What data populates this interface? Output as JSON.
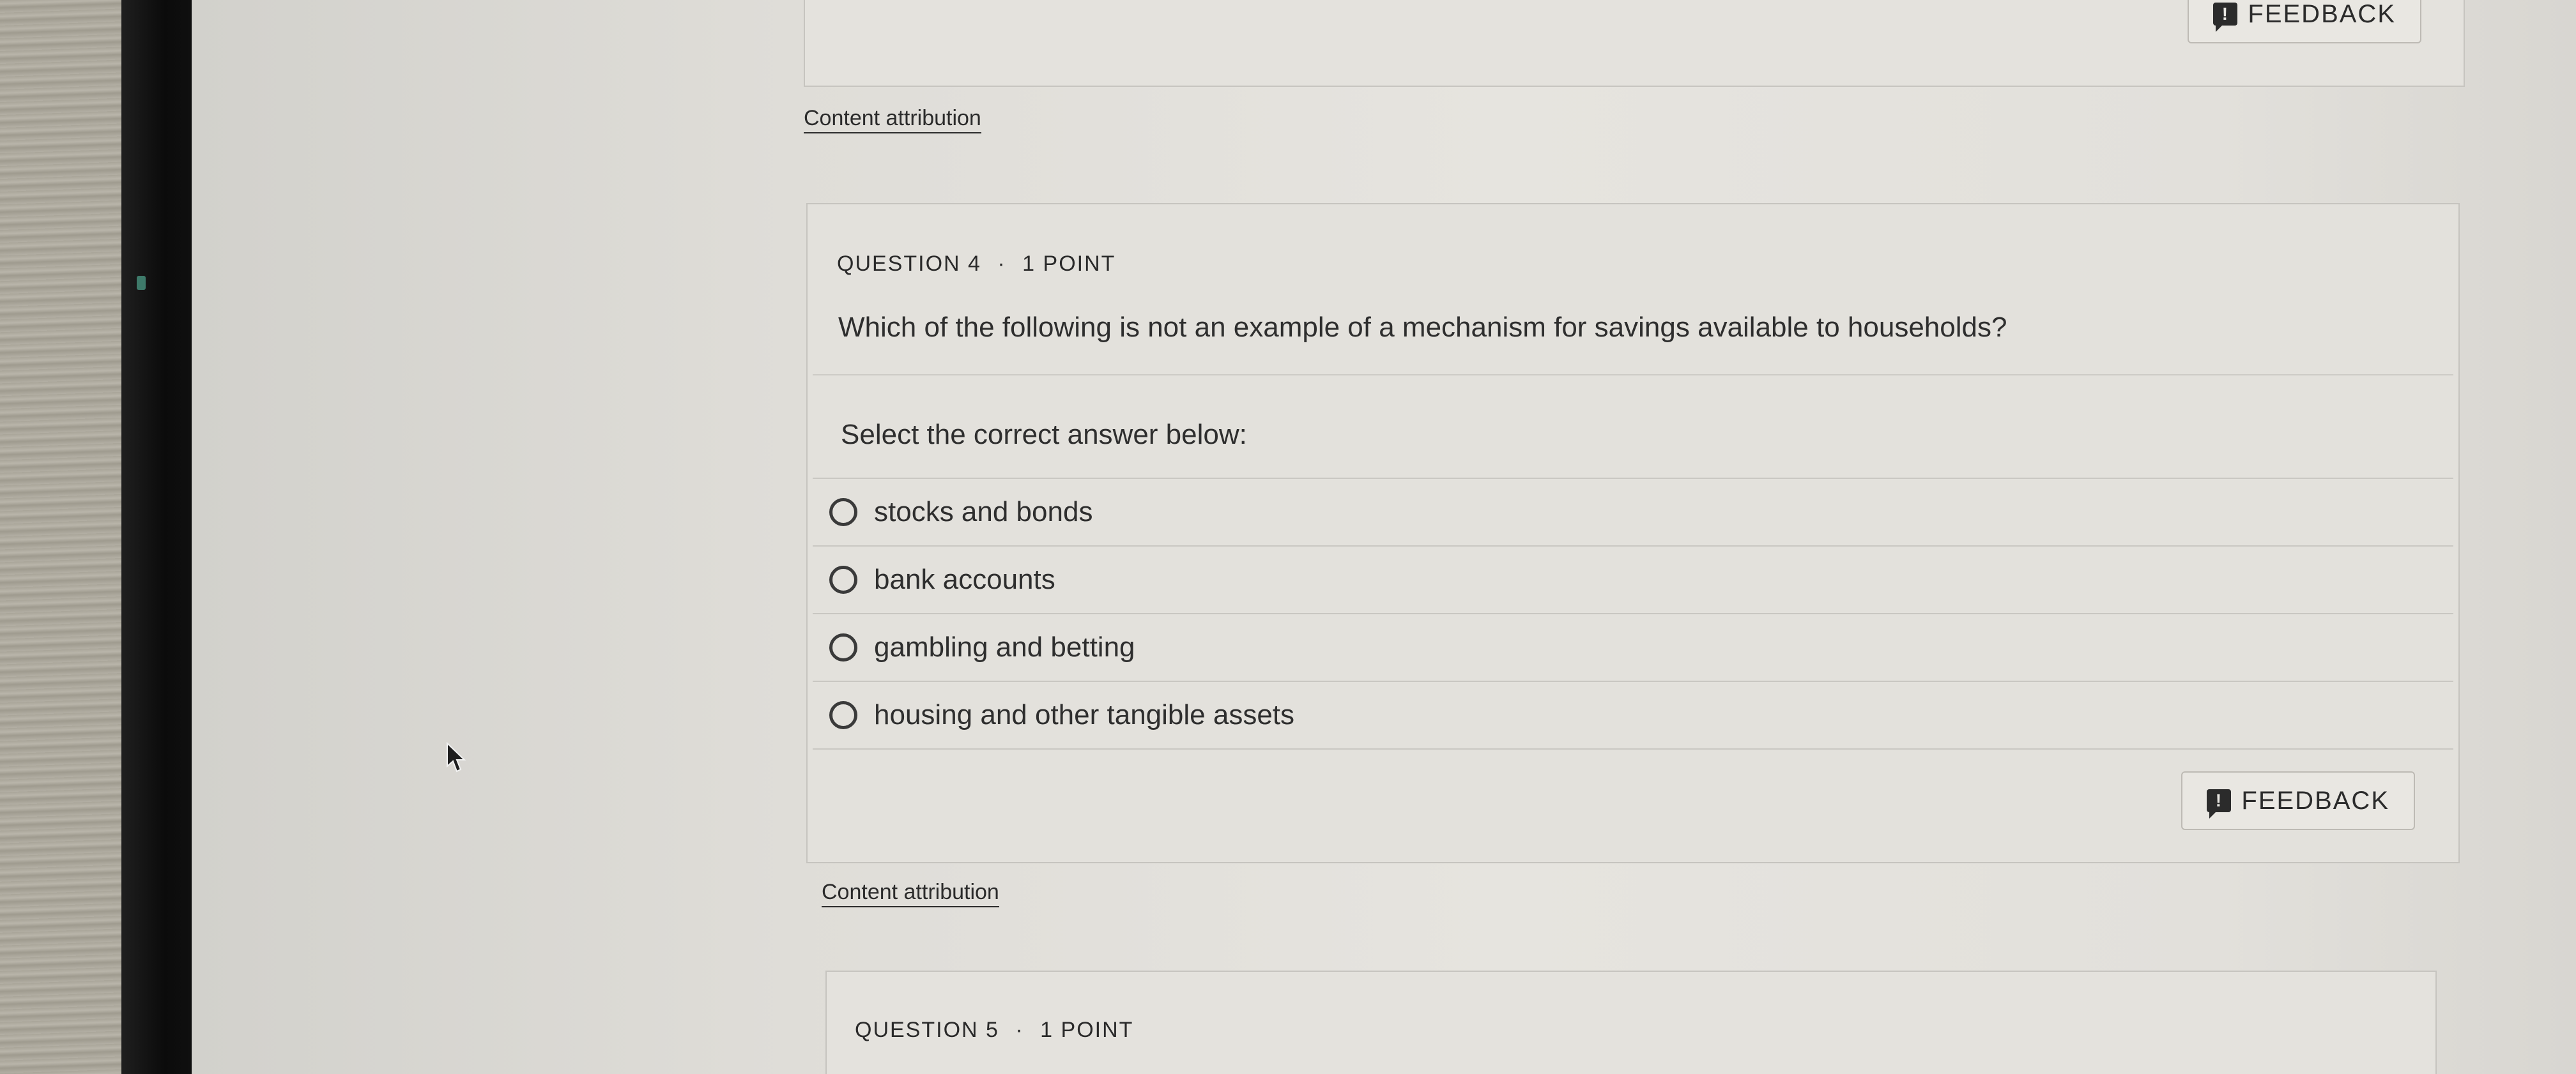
{
  "top_card": {
    "feedback_label": "FEEDBACK",
    "attribution": "Content attribution"
  },
  "question4": {
    "number_label": "QUESTION 4",
    "separator": "·",
    "points": "1 POINT",
    "prompt": "Which of the following is not an example of a mechanism for savings available to households?",
    "instruction": "Select the correct answer below:",
    "options": [
      {
        "label": "stocks and bonds",
        "selected": false
      },
      {
        "label": "bank accounts",
        "selected": false
      },
      {
        "label": "gambling and betting",
        "selected": false
      },
      {
        "label": "housing and other tangible assets",
        "selected": false
      }
    ],
    "feedback_label": "FEEDBACK",
    "attribution": "Content attribution"
  },
  "question5": {
    "number_label": "QUESTION 5",
    "separator": "·",
    "points": "1 POINT"
  },
  "icons": {
    "feedback": "feedback-icon",
    "radio": "radio-unselected-icon",
    "cursor": "mouse-pointer-icon"
  }
}
